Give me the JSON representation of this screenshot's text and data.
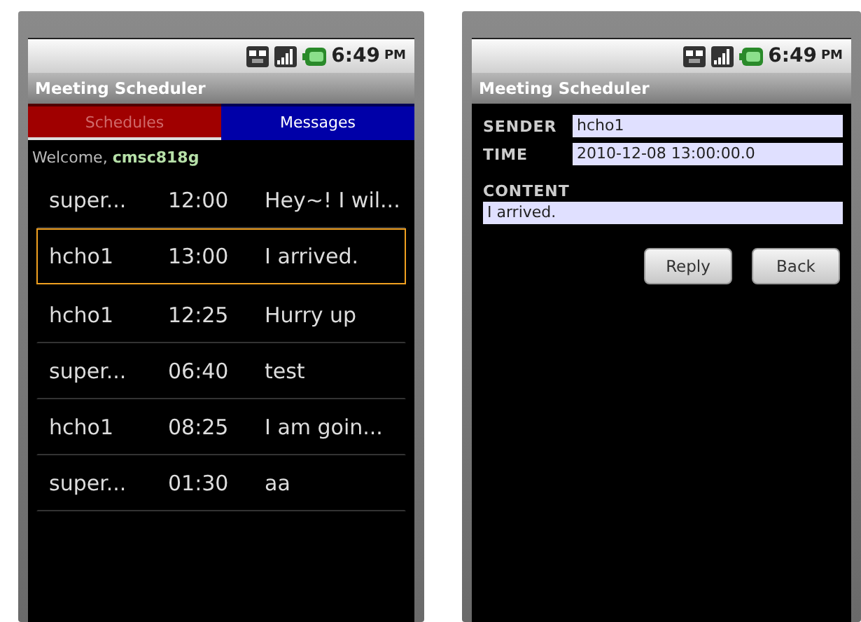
{
  "phones": [
    {
      "kind": "list",
      "status": {
        "time": "6:49",
        "ampm": "PM"
      },
      "title": "Meeting Scheduler",
      "tabs": [
        {
          "label": "Schedules",
          "selected": false,
          "color": "#a00000"
        },
        {
          "label": "Messages",
          "selected": true,
          "color": "#0000a8"
        }
      ],
      "welcome": {
        "prefix": "Welcome,",
        "user": "cmsc818g"
      },
      "messages": [
        {
          "sender": "super...",
          "time": "12:00",
          "text": "Hey~! I wil...",
          "selected": false
        },
        {
          "sender": "hcho1",
          "time": "13:00",
          "text": "I arrived.",
          "selected": true
        },
        {
          "sender": "hcho1",
          "time": "12:25",
          "text": "Hurry up",
          "selected": false
        },
        {
          "sender": "super...",
          "time": "06:40",
          "text": "test",
          "selected": false
        },
        {
          "sender": "hcho1",
          "time": "08:25",
          "text": "I am goin...",
          "selected": false
        },
        {
          "sender": "super...",
          "time": "01:30",
          "text": "aa",
          "selected": false
        }
      ]
    },
    {
      "kind": "detail",
      "status": {
        "time": "6:49",
        "ampm": "PM"
      },
      "title": "Meeting Scheduler",
      "fields": [
        {
          "label": "SENDER",
          "value": "hcho1"
        },
        {
          "label": "TIME",
          "value": "2010-12-08 13:00:00.0"
        }
      ],
      "content": {
        "label": "CONTENT",
        "value": "I arrived."
      },
      "buttons": [
        "Reply",
        "Back"
      ]
    }
  ]
}
